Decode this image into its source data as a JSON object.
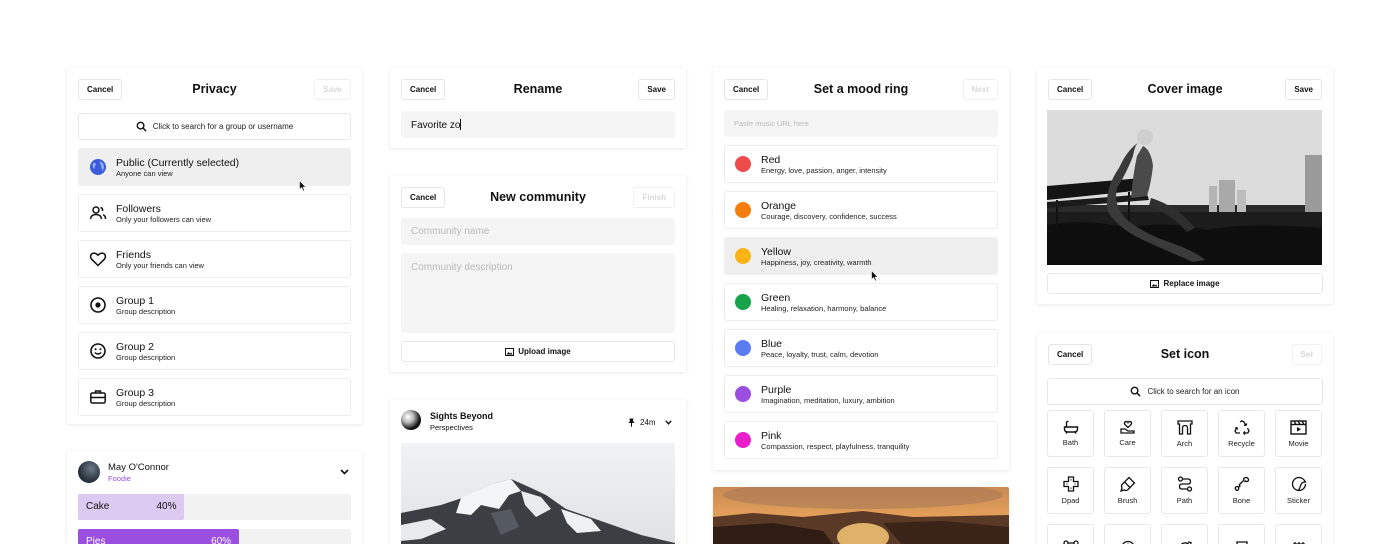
{
  "privacy": {
    "title": "Privacy",
    "cancel": "Cancel",
    "save": "Save",
    "search_placeholder": "Click to search for a group or username",
    "options": [
      {
        "title": "Public (Currently selected)",
        "sub": "Anyone can view",
        "icon": "globe-icon"
      },
      {
        "title": "Followers",
        "sub": "Only your followers can view",
        "icon": "people-icon"
      },
      {
        "title": "Friends",
        "sub": "Only your friends can view",
        "icon": "heart-icon"
      },
      {
        "title": "Group 1",
        "sub": "Group description",
        "icon": "target-icon"
      },
      {
        "title": "Group 2",
        "sub": "Group description",
        "icon": "smiley-icon"
      },
      {
        "title": "Group 3",
        "sub": "Group description",
        "icon": "briefcase-icon"
      }
    ]
  },
  "poll": {
    "user": "May O'Connor",
    "role": "Foodie",
    "rows": [
      {
        "label": "Cake",
        "percent": "40%",
        "fraction": 0.4,
        "color": "#dccaf3"
      },
      {
        "label": "Pies",
        "percent": "60%",
        "fraction": 0.6,
        "color": "#9a4fe0"
      }
    ]
  },
  "rename": {
    "title": "Rename",
    "cancel": "Cancel",
    "save": "Save",
    "value": "Favorite zo"
  },
  "community": {
    "title": "New community",
    "cancel": "Cancel",
    "finish": "Finish",
    "name_placeholder": "Community name",
    "desc_placeholder": "Community description",
    "upload": "Upload image"
  },
  "post": {
    "author": "Sights Beyond",
    "subtitle": "Perspectives",
    "time": "24m"
  },
  "mood": {
    "title": "Set a mood ring",
    "cancel": "Cancel",
    "next": "Next",
    "url_placeholder": "Paste music URL here",
    "items": [
      {
        "name": "Red",
        "desc": "Energy, love, passion, anger, intensity",
        "color": "#ee4b4b"
      },
      {
        "name": "Orange",
        "desc": "Courage, discovery, confidence, success",
        "color": "#f57d10"
      },
      {
        "name": "Yellow",
        "desc": "Happiness, joy, creativity, warmth",
        "color": "#f8b417"
      },
      {
        "name": "Green",
        "desc": "Healing, relaxation, harmony, balance",
        "color": "#16a34a"
      },
      {
        "name": "Blue",
        "desc": "Peace, loyalty, trust, calm, devotion",
        "color": "#5b7cf0"
      },
      {
        "name": "Purple",
        "desc": "Imagination, meditation, luxury, ambition",
        "color": "#9b4fe0"
      },
      {
        "name": "Pink",
        "desc": "Compassion, respect, playfulness, tranquility",
        "color": "#e91ec8"
      }
    ]
  },
  "cover": {
    "title": "Cover image",
    "cancel": "Cancel",
    "save": "Save",
    "replace": "Replace image"
  },
  "seticon": {
    "title": "Set icon",
    "cancel": "Cancel",
    "set": "Set",
    "search_placeholder": "Click to search for an icon",
    "icons": [
      {
        "label": "Bath",
        "icon": "bath-icon"
      },
      {
        "label": "Care",
        "icon": "care-icon"
      },
      {
        "label": "Arch",
        "icon": "arch-icon"
      },
      {
        "label": "Recycle",
        "icon": "recycle-icon"
      },
      {
        "label": "Movie",
        "icon": "movie-icon"
      },
      {
        "label": "Dpad",
        "icon": "dpad-icon"
      },
      {
        "label": "Brush",
        "icon": "brush-icon"
      },
      {
        "label": "Path",
        "icon": "path-icon"
      },
      {
        "label": "Bone",
        "icon": "bone-icon"
      },
      {
        "label": "Sticker",
        "icon": "sticker-icon"
      }
    ]
  }
}
